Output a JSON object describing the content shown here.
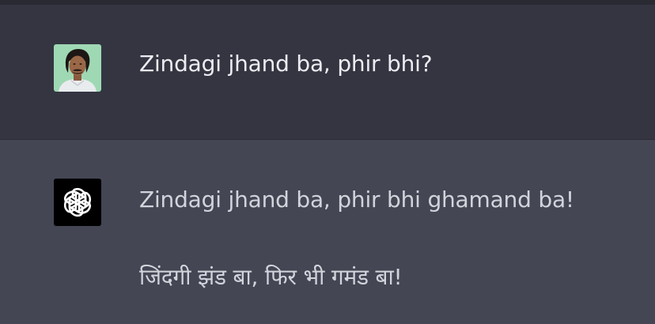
{
  "conversation": {
    "user_message": {
      "text": "Zindagi jhand ba, phir bhi?",
      "avatar_icon": "user-photo-avatar"
    },
    "assistant_message": {
      "avatar_icon": "openai-logo-icon",
      "line_1": "Zindagi jhand ba, phir bhi ghamand ba!",
      "line_2": "जिंदगी झंड बा, फिर भी गमंड बा!"
    }
  },
  "colors": {
    "user_bg": "#343541",
    "assistant_bg": "#444654",
    "top_strip": "#2a2b32",
    "text_primary": "#ececf1",
    "text_secondary": "#d1d5db",
    "avatar_green": "#9fd9b4"
  }
}
